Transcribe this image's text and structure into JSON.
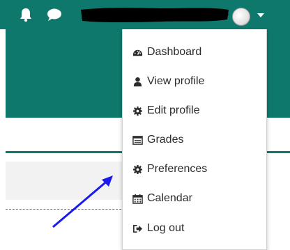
{
  "colors": {
    "brand": "#0f786c",
    "menu_text": "#2c2c2c",
    "arrow": "#1a1aee"
  },
  "topbar": {
    "icons": [
      "bell-icon",
      "chat-icon"
    ],
    "user_name_redacted": true
  },
  "user_menu": {
    "items": [
      {
        "label": "Dashboard",
        "icon": "dashboard-icon"
      },
      {
        "label": "View profile",
        "icon": "user-icon"
      },
      {
        "label": "Edit profile",
        "icon": "cog-icon"
      },
      {
        "label": "Grades",
        "icon": "table-icon"
      },
      {
        "label": "Preferences",
        "icon": "cog-icon"
      },
      {
        "label": "Calendar",
        "icon": "calendar-icon"
      },
      {
        "label": "Log out",
        "icon": "sign-out-icon"
      }
    ]
  }
}
